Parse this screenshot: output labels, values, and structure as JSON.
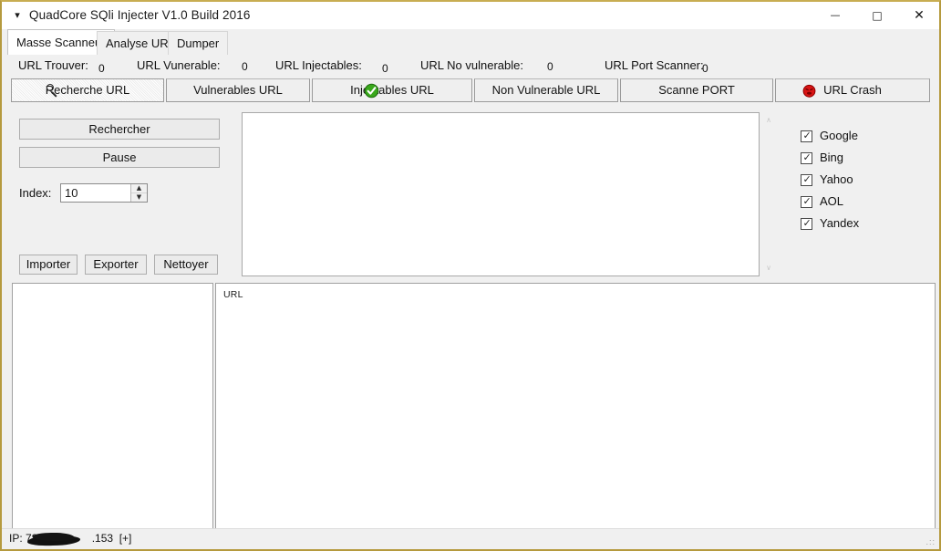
{
  "window": {
    "title": "QuadCore SQli Injecter V1.0 Build 2016",
    "icon": "chevron-down-icon",
    "minimize": "—",
    "maximize": "□",
    "close": "✕"
  },
  "tabs": [
    {
      "label": "Masse Scanneur",
      "active": true
    },
    {
      "label": "Analyse URL",
      "active": false
    },
    {
      "label": "Dumper",
      "active": false
    }
  ],
  "counters": [
    {
      "label": "URL Trouver:",
      "value": "0"
    },
    {
      "label": "URL Vunerable:",
      "value": "0"
    },
    {
      "label": "URL Injectables:",
      "value": "0"
    },
    {
      "label": "URL No vulnerable:",
      "value": "0"
    },
    {
      "label": "URL Port Scanner:",
      "value": "0"
    }
  ],
  "action_bar": [
    {
      "label": "Recherche URL",
      "icon": "magnifier-icon",
      "selected": true
    },
    {
      "label": "Vulnerables URL",
      "icon": "",
      "selected": false
    },
    {
      "label": "Injectables URL",
      "icon": "green-check-circle-icon",
      "selected": false
    },
    {
      "label": "Non Vulnerable URL",
      "icon": "",
      "selected": false
    },
    {
      "label": "Scanne PORT",
      "icon": "",
      "selected": false
    },
    {
      "label": "URL Crash",
      "icon": "red-crash-face-icon",
      "selected": false
    }
  ],
  "controls": {
    "rechercher": "Rechercher",
    "pause": "Pause",
    "index_label": "Index:",
    "index_value": "10",
    "spin_up": "▲",
    "spin_down": "▼",
    "importer": "Importer",
    "exporter": "Exporter",
    "nettoyer": "Nettoyer"
  },
  "log_panel": {
    "content": "",
    "scroll_up": "∧",
    "scroll_down": "∨"
  },
  "engines": [
    {
      "label": "Google",
      "checked": true
    },
    {
      "label": "Bing",
      "checked": true
    },
    {
      "label": "Yahoo",
      "checked": true
    },
    {
      "label": "AOL",
      "checked": true
    },
    {
      "label": "Yandex",
      "checked": true
    }
  ],
  "check_glyph": "✓",
  "url_list": {
    "column_header": "URL",
    "rows": []
  },
  "status_bar": {
    "ip_prefix": "IP:  78.",
    "ip_suffix": ".153",
    "expand": "[+]",
    "grip": ".::"
  },
  "colors": {
    "window_border": "#b59a3e",
    "face": "#f0f0f0",
    "green_icon": "#2f9e1f",
    "red_icon": "#d81414"
  }
}
